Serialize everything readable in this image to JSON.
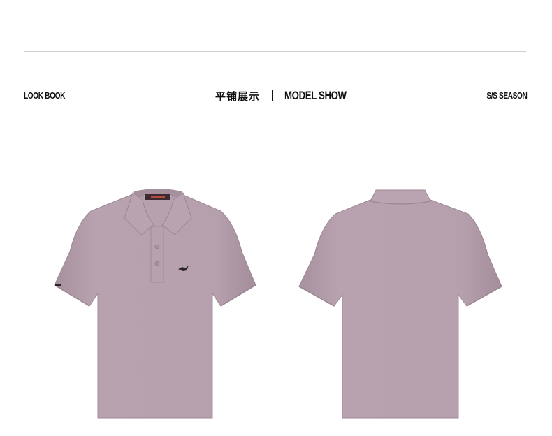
{
  "header": {
    "left_label": "LOOK BOOK",
    "center_cn": "平铺展示",
    "center_en": "MODEL SHOW",
    "right_label": "S/S SEASON"
  },
  "products": [
    {
      "view": "front",
      "icon": "polo-shirt-front-icon",
      "color": "#b59fad"
    },
    {
      "view": "back",
      "icon": "polo-shirt-back-icon",
      "color": "#b59fad"
    }
  ]
}
